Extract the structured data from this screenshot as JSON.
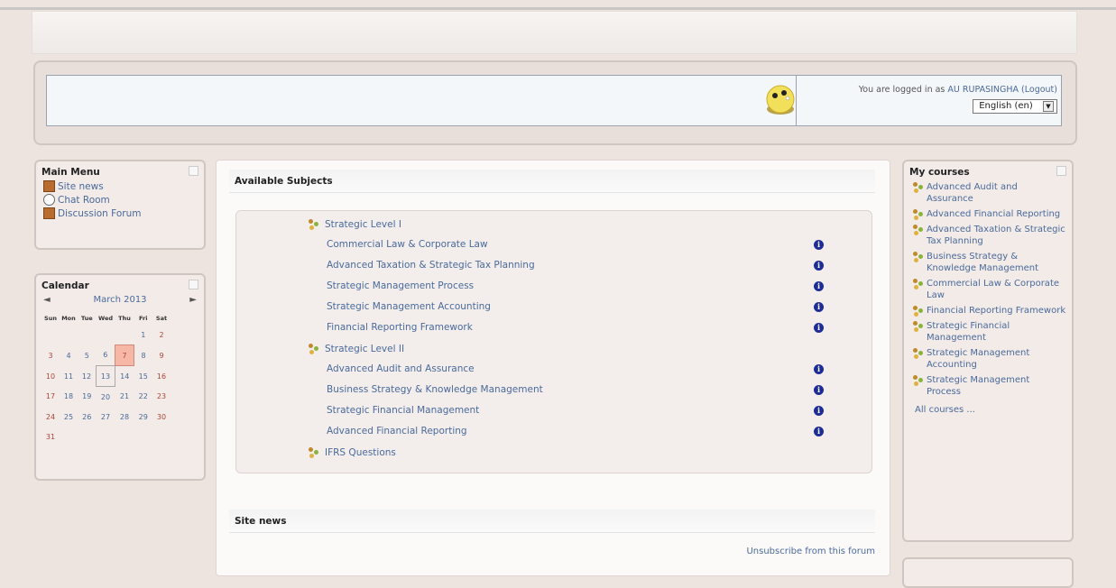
{
  "header": {
    "login_prefix": "You are logged in as",
    "user_name": "AU RUPASINGHA",
    "logout": "(Logout)",
    "language": "English (en)"
  },
  "main_menu": {
    "title": "Main Menu",
    "items": [
      {
        "label": "Site news",
        "icon": "news-icon"
      },
      {
        "label": "Chat Room",
        "icon": "chat-icon"
      },
      {
        "label": "Discussion Forum",
        "icon": "forum-icon"
      }
    ]
  },
  "calendar": {
    "title": "Calendar",
    "prev": "◄",
    "next": "►",
    "month": "March 2013",
    "weekdays": [
      "Sun",
      "Mon",
      "Tue",
      "Wed",
      "Thu",
      "Fri",
      "Sat"
    ],
    "weeks": [
      [
        "",
        "",
        "",
        "",
        "",
        "1",
        "2"
      ],
      [
        "3",
        "4",
        "5",
        "6",
        "7",
        "8",
        "9"
      ],
      [
        "10",
        "11",
        "12",
        "13",
        "14",
        "15",
        "16"
      ],
      [
        "17",
        "18",
        "19",
        "20",
        "21",
        "22",
        "23"
      ],
      [
        "24",
        "25",
        "26",
        "27",
        "28",
        "29",
        "30"
      ],
      [
        "31",
        "",
        "",
        "",
        "",
        "",
        ""
      ]
    ],
    "event_day": "7",
    "today": "13"
  },
  "available_subjects": {
    "title": "Available Subjects",
    "categories": [
      {
        "label": "Strategic Level I",
        "subjects": [
          "Commercial Law & Corporate Law",
          "Advanced Taxation & Strategic Tax Planning",
          "Strategic Management Process",
          "Strategic Management Accounting",
          "Financial Reporting Framework"
        ]
      },
      {
        "label": "Strategic Level II",
        "subjects": [
          "Advanced Audit and Assurance",
          "Business Strategy & Knowledge Management",
          "Strategic Financial Management",
          "Advanced Financial Reporting"
        ]
      },
      {
        "label": "IFRS Questions",
        "subjects": []
      }
    ],
    "info_glyph": "i"
  },
  "site_news": {
    "title": "Site news",
    "unsubscribe": "Unsubscribe from this forum"
  },
  "my_courses": {
    "title": "My courses",
    "items": [
      "Advanced Audit and Assurance",
      "Advanced Financial Reporting",
      "Advanced Taxation & Strategic Tax Planning",
      "Business Strategy & Knowledge Management",
      "Commercial Law & Corporate Law",
      "Financial Reporting Framework",
      "Strategic Financial Management",
      "Strategic Management Accounting",
      "Strategic Management Process"
    ],
    "all_courses": "All courses ..."
  }
}
